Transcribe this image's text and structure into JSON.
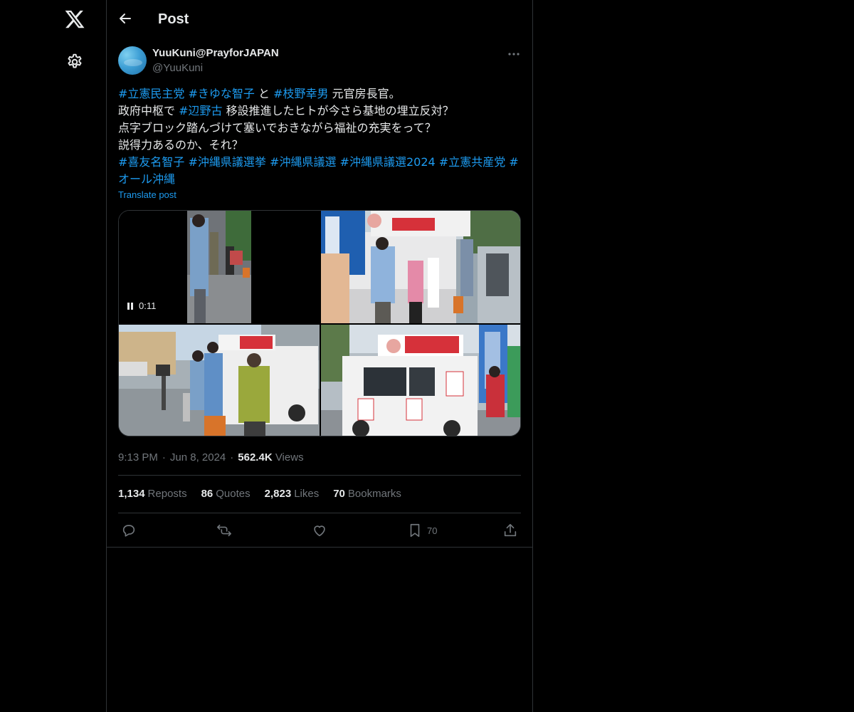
{
  "header": {
    "title": "Post"
  },
  "post": {
    "display_name": "YuuKuni@PrayforJAPAN",
    "handle": "@YuuKuni",
    "text": {
      "line1": {
        "tag1": "#立憲民主党",
        "tag2": "#きゆな智子",
        "t1": "と",
        "tag3": "#枝野幸男",
        "t2": "元官房長官。"
      },
      "line2": {
        "t1": "政府中枢で",
        "tag1": "#辺野古",
        "t2": "移設推進したヒトが今さら基地の埋立反対？"
      },
      "line3": "点字ブロック踏んづけて塞いでおきながら福祉の充実をって？",
      "line4": "説得力あるのか、それ？",
      "line5": {
        "tag1": "#喜友名智子",
        "tag2": "#沖縄県議選挙",
        "tag3": "#沖縄県議選",
        "tag4": "#沖縄県議選2024",
        "tag5": "#立憲共産党",
        "tag6": "#"
      },
      "line6": {
        "tag1": "オール沖縄"
      }
    },
    "translate_label": "Translate post",
    "media": {
      "video_time": "0:11"
    },
    "time": "9:13 PM",
    "date": "Jun 8, 2024",
    "views_count": "562.4K",
    "views_label": "Views",
    "stats": {
      "reposts_count": "1,134",
      "reposts_label": "Reposts",
      "quotes_count": "86",
      "quotes_label": "Quotes",
      "likes_count": "2,823",
      "likes_label": "Likes",
      "bookmarks_count": "70",
      "bookmarks_label": "Bookmarks"
    },
    "actions": {
      "bookmark_count": "70"
    }
  },
  "icons": [
    "x-logo-icon",
    "settings-icon",
    "back-arrow-icon",
    "more-icon",
    "pause-icon",
    "reply-icon",
    "repost-icon",
    "like-icon",
    "bookmark-icon",
    "share-icon"
  ],
  "colors": {
    "background": "#000000",
    "text": "#e7e9ea",
    "muted": "#71767b",
    "accent": "#1d9bf0",
    "border": "#2f3336"
  }
}
